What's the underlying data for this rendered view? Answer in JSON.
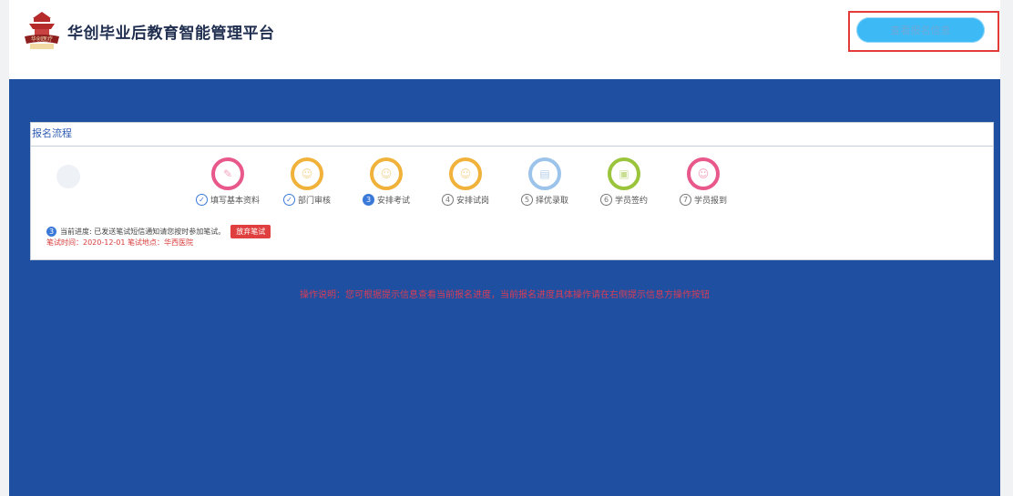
{
  "header": {
    "title": "华创毕业后教育智能管理平台",
    "logo_text": "华创医疗",
    "view_button_label": "查看报名信息"
  },
  "panel": {
    "title": "报名流程",
    "steps": [
      {
        "num": "✓",
        "label": "填写基本资料",
        "state": "done",
        "color": "#e8588a",
        "icon": "edit-icon"
      },
      {
        "num": "✓",
        "label": "部门审核",
        "state": "done",
        "color": "#f0b23a",
        "icon": "user-check-icon"
      },
      {
        "num": "3",
        "label": "安排考试",
        "state": "active",
        "color": "#f0b23a",
        "icon": "user-icon"
      },
      {
        "num": "4",
        "label": "安排试岗",
        "state": "pending",
        "color": "#f0b23a",
        "icon": "user-icon"
      },
      {
        "num": "5",
        "label": "择优录取",
        "state": "pending",
        "color": "#9cc3ea",
        "icon": "document-icon"
      },
      {
        "num": "6",
        "label": "学员签约",
        "state": "pending",
        "color": "#9ac43c",
        "icon": "contract-icon"
      },
      {
        "num": "7",
        "label": "学员报到",
        "state": "pending",
        "color": "#e8588a",
        "icon": "person-icon"
      }
    ],
    "progress": {
      "step_num": "3",
      "text": "当前进度: 已发送笔试短信通知请您按时参加笔试。",
      "abandon_label": "放弃笔试"
    },
    "exam_info": "笔试时间：2020-12-01   笔试地点：华西医院"
  },
  "operation_note": "操作说明：您可根据提示信息查看当前报名进度，当前报名进度具体操作请在右侧提示信息方操作按钮"
}
